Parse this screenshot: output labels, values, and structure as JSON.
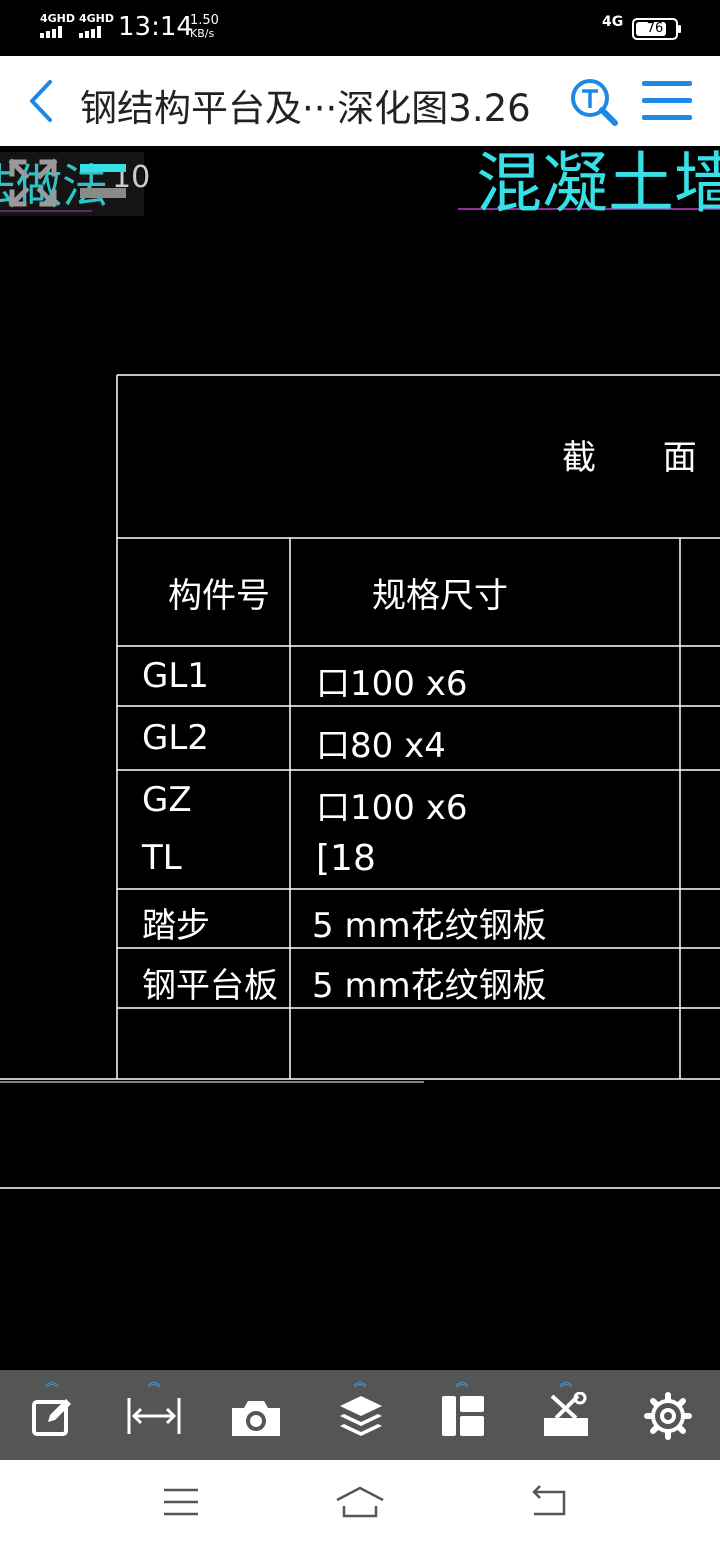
{
  "status_bar": {
    "network1": "4GHD",
    "network2": "4GHD",
    "time": "13:14",
    "speed_value": "1.50",
    "speed_unit": "KB/s",
    "network_right": "4G",
    "battery": "76"
  },
  "title_bar": {
    "title": "钢结构平台及···深化图3.26",
    "back_icon": "chevron-left-icon",
    "search_icon": "text-search-icon",
    "menu_icon": "hamburger-menu-icon"
  },
  "drawing": {
    "top_left_text": "法做法",
    "top_left_suffix": "10",
    "top_right_text": "混凝土墙抗",
    "table": {
      "header_section": "截 面",
      "col_headers": [
        "构件号",
        "规格尺寸"
      ],
      "rows": [
        {
          "id": "GL1",
          "spec": "口100 x6"
        },
        {
          "id": "GL2",
          "spec": "口80 x4"
        },
        {
          "id": "GZ",
          "spec": "口100 x6"
        },
        {
          "id": "TL",
          "spec": "[18"
        },
        {
          "id": "踏步",
          "spec": "5 mm花纹钢板"
        },
        {
          "id": "钢平台板",
          "spec": "5 mm花纹钢板"
        }
      ]
    },
    "colors": {
      "line": "#ffffff",
      "cyan_text": "#37e0e6",
      "magenta_line": "#c040c0"
    }
  },
  "toolbar": {
    "tools": [
      {
        "icon": "edit-icon",
        "has_expand": true
      },
      {
        "icon": "measure-icon",
        "has_expand": true
      },
      {
        "icon": "camera-icon",
        "has_expand": false
      },
      {
        "icon": "layers-icon",
        "has_expand": true
      },
      {
        "icon": "layout-icon",
        "has_expand": true
      },
      {
        "icon": "toolbox-icon",
        "has_expand": true
      },
      {
        "icon": "settings-icon",
        "has_expand": false
      }
    ],
    "accent": "#3fa9f5"
  },
  "nav_bar": {
    "icons": [
      "recent-apps-icon",
      "home-icon",
      "back-icon"
    ]
  }
}
